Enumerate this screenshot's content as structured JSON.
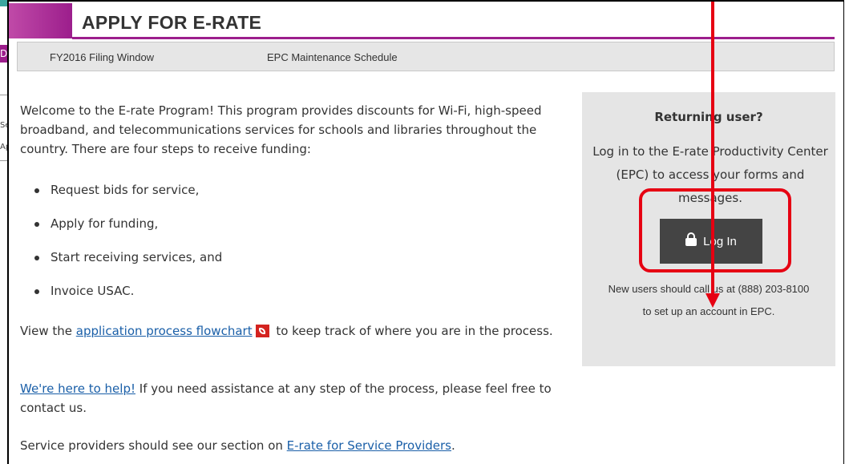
{
  "background_fragments": {
    "purple_tab_text": "D",
    "text_1": "Se",
    "text_2": "Ap"
  },
  "header": {
    "title": "APPLY FOR E-RATE",
    "accent_color": "#9c1e8c"
  },
  "subnav": {
    "items": [
      "FY2016 Filing Window",
      "EPC Maintenance Schedule"
    ]
  },
  "main": {
    "intro": "Welcome to the E-rate Program! This program provides discounts for Wi-Fi, high-speed broadband, and telecommunications services for schools and libraries throughout the country. There are four steps to receive funding:",
    "steps": [
      "Request bids for service,",
      "Apply for funding,",
      "Start receiving services, and",
      "Invoice USAC."
    ],
    "flowchart_prefix": "View the",
    "flowchart_link": "application process flowchart",
    "flowchart_suffix": "to keep track of where you are in the process.",
    "help_link": "We're here to help!",
    "help_suffix": "If you need assistance at any step of the process, please feel free to contact us.",
    "providers_prefix": "Service providers should see our section on",
    "providers_link": "E-rate for Service Providers",
    "providers_suffix": "."
  },
  "sidebar": {
    "heading": "Returning user?",
    "description": "Log in to the E-rate Productivity Center (EPC) to access your forms and messages.",
    "login_label": "Log In",
    "new_users_line1": "New users should call us at (888) 203-8100",
    "new_users_line2": "to set up an account in EPC."
  },
  "annotation": {
    "color": "#e60012"
  }
}
